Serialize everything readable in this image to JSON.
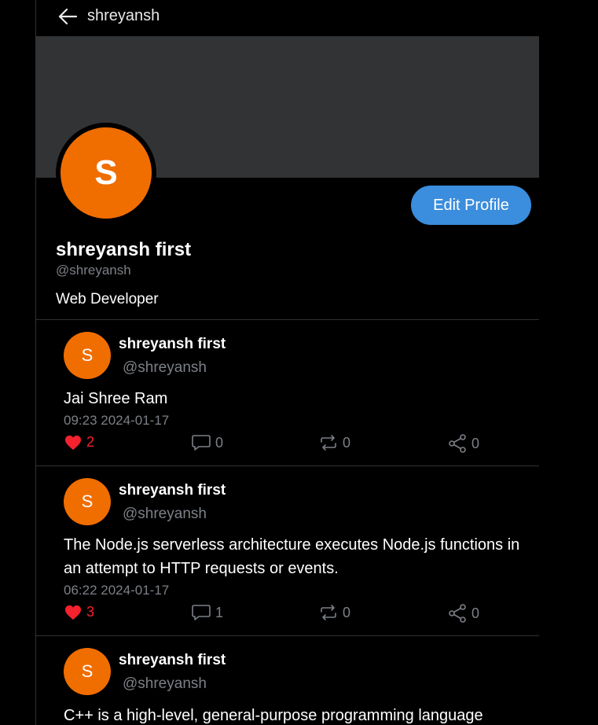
{
  "header": {
    "title": "shreyansh"
  },
  "profile": {
    "avatar_letter": "S",
    "name": "shreyansh first",
    "handle": "@shreyansh",
    "bio": "Web Developer",
    "edit_label": "Edit Profile"
  },
  "colors": {
    "avatar": "#f06d00",
    "button": "#3b8ddd",
    "like": "#f4212e",
    "banner": "#313335"
  },
  "posts": [
    {
      "avatar_letter": "S",
      "name": "shreyansh first",
      "handle": "@shreyansh",
      "text": "Jai Shree Ram",
      "time": "09:23 2024-01-17",
      "likes": "2",
      "comments": "0",
      "reposts": "0",
      "shares": "0"
    },
    {
      "avatar_letter": "S",
      "name": "shreyansh first",
      "handle": "@shreyansh",
      "text": "The Node.js serverless architecture executes Node.js functions in an attempt to HTTP requests or events.",
      "time": "06:22 2024-01-17",
      "likes": "3",
      "comments": "1",
      "reposts": "0",
      "shares": "0"
    },
    {
      "avatar_letter": "S",
      "name": "shreyansh first",
      "handle": "@shreyansh",
      "text": "C++ is a high-level, general-purpose programming language"
    }
  ]
}
